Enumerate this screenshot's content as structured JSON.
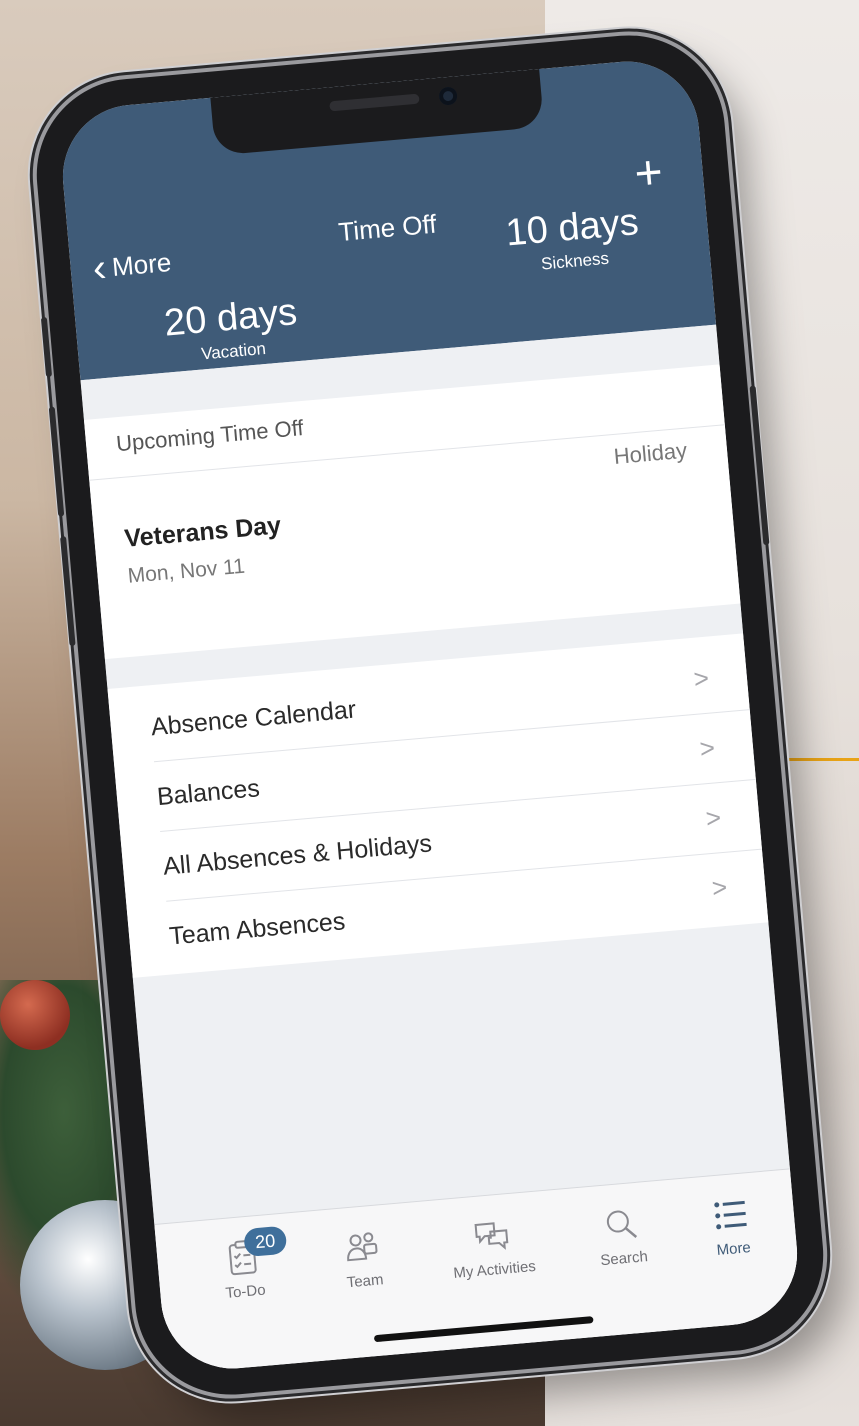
{
  "header": {
    "back_label": "More",
    "title": "Time Off",
    "add_icon": "+",
    "vacation": {
      "value": "20 days",
      "label": "Vacation"
    },
    "sickness": {
      "value": "10 days",
      "label": "Sickness"
    }
  },
  "upcoming": {
    "heading": "Upcoming Time Off",
    "event_name": "Veterans Day",
    "event_date": "Mon, Nov 11",
    "event_type": "Holiday"
  },
  "menu": {
    "items": [
      {
        "label": "Absence Calendar"
      },
      {
        "label": "Balances"
      },
      {
        "label": "All Absences & Holidays"
      },
      {
        "label": "Team Absences"
      }
    ],
    "chevron": ">"
  },
  "tabbar": {
    "todo": {
      "label": "To-Do",
      "badge": "20"
    },
    "team": {
      "label": "Team"
    },
    "activities": {
      "label": "My Activities"
    },
    "search": {
      "label": "Search"
    },
    "more": {
      "label": "More"
    }
  },
  "colors": {
    "header_bg": "#3f5b78",
    "accent_line": "#e8a317",
    "badge_bg": "#3f6f9b"
  }
}
